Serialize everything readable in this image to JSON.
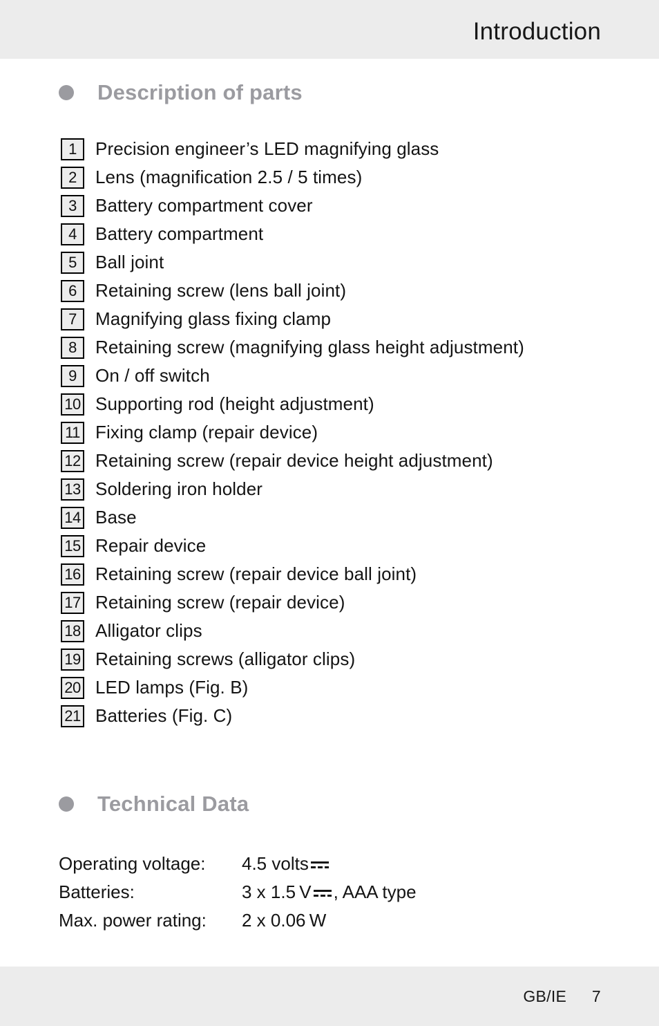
{
  "header": {
    "title": "Introduction"
  },
  "sections": {
    "description": {
      "bullet_icon": "filled-circle-bullet-icon",
      "heading": "Description of parts"
    },
    "technical": {
      "bullet_icon": "filled-circle-bullet-icon",
      "heading": "Technical Data"
    }
  },
  "parts": [
    {
      "num": "1",
      "label": "Precision engineer’s LED magnifying glass"
    },
    {
      "num": "2",
      "label": "Lens (magnification 2.5 / 5 times)"
    },
    {
      "num": "3",
      "label": "Battery compartment cover"
    },
    {
      "num": "4",
      "label": "Battery compartment"
    },
    {
      "num": "5",
      "label": "Ball joint"
    },
    {
      "num": "6",
      "label": "Retaining screw (lens ball joint)"
    },
    {
      "num": "7",
      "label": "Magnifying glass fixing clamp"
    },
    {
      "num": "8",
      "label": "Retaining screw (magnifying glass height adjustment)"
    },
    {
      "num": "9",
      "label": "On / off switch"
    },
    {
      "num": "10",
      "label": "Supporting rod (height adjustment)"
    },
    {
      "num": "11",
      "label": "Fixing clamp (repair device)"
    },
    {
      "num": "12",
      "label": "Retaining screw (repair device height adjustment)"
    },
    {
      "num": "13",
      "label": "Soldering iron holder"
    },
    {
      "num": "14",
      "label": "Base"
    },
    {
      "num": "15",
      "label": "Repair device"
    },
    {
      "num": "16",
      "label": "Retaining screw (repair device ball joint)"
    },
    {
      "num": "17",
      "label": "Retaining screw (repair device)"
    },
    {
      "num": "18",
      "label": "Alligator clips"
    },
    {
      "num": "19",
      "label": "Retaining screws (alligator clips)"
    },
    {
      "num": "20",
      "label": "LED lamps (Fig. B)"
    },
    {
      "num": "21",
      "label": "Batteries (Fig. C)"
    }
  ],
  "technical_data": [
    {
      "label": "Operating voltage:",
      "value_before": "4.5 volts ",
      "dc_symbol": "dc-current-icon",
      "value_after": ""
    },
    {
      "label": "Batteries:",
      "value_before": "3 x 1.5 V ",
      "dc_symbol": "dc-current-icon",
      "value_after": ", AAA type"
    },
    {
      "label": "Max. power rating:",
      "value_before": "2 x 0.06 W",
      "dc_symbol": "",
      "value_after": ""
    }
  ],
  "footer": {
    "locale": "GB/IE",
    "page_number": "7"
  },
  "colors": {
    "band_background": "#ececec",
    "heading_gray": "#9b9ba0",
    "text_black": "#141414",
    "number_box_fill": "#ececec",
    "number_box_border": "#000000",
    "page_background": "#ffffff"
  }
}
